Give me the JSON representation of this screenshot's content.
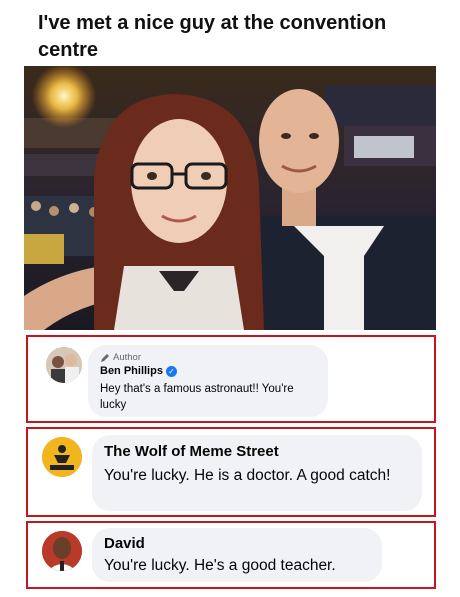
{
  "post": {
    "caption": "I've met a nice guy at the convention centre"
  },
  "comments": [
    {
      "tag": "Author",
      "name": "Ben Phillips",
      "verified": true,
      "text": "Hey that's a famous astronaut!! You're lucky"
    },
    {
      "name": "The Wolf of Meme Street",
      "text": "You're lucky. He is a doctor. A good catch!",
      "avatar_text": "THE WOLF OF MEME STREET"
    },
    {
      "name": "David",
      "text": "You're lucky. He's a good teacher."
    }
  ],
  "colors": {
    "highlight_border": "#c4161c",
    "bubble_bg": "#f0f2f5",
    "verified_badge": "#1877f2"
  }
}
